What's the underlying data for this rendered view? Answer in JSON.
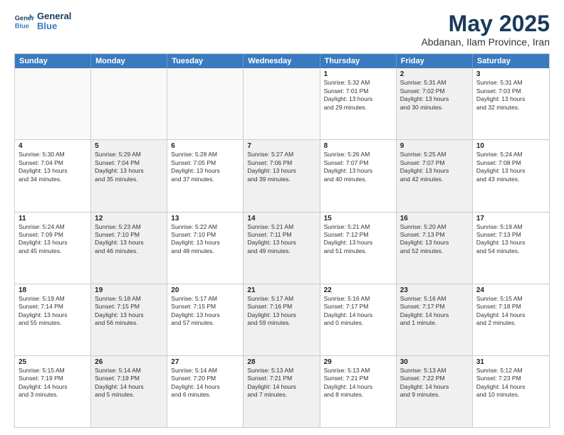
{
  "logo": {
    "line1": "General",
    "line2": "Blue"
  },
  "title": "May 2025",
  "subtitle": "Abdanan, Ilam Province, Iran",
  "headers": [
    "Sunday",
    "Monday",
    "Tuesday",
    "Wednesday",
    "Thursday",
    "Friday",
    "Saturday"
  ],
  "weeks": [
    [
      {
        "num": "",
        "info": "",
        "empty": true
      },
      {
        "num": "",
        "info": "",
        "empty": true
      },
      {
        "num": "",
        "info": "",
        "empty": true
      },
      {
        "num": "",
        "info": "",
        "empty": true
      },
      {
        "num": "1",
        "info": "Sunrise: 5:32 AM\nSunset: 7:01 PM\nDaylight: 13 hours\nand 29 minutes.",
        "shaded": false
      },
      {
        "num": "2",
        "info": "Sunrise: 5:31 AM\nSunset: 7:02 PM\nDaylight: 13 hours\nand 30 minutes.",
        "shaded": true
      },
      {
        "num": "3",
        "info": "Sunrise: 5:31 AM\nSunset: 7:03 PM\nDaylight: 13 hours\nand 32 minutes.",
        "shaded": false
      }
    ],
    [
      {
        "num": "4",
        "info": "Sunrise: 5:30 AM\nSunset: 7:04 PM\nDaylight: 13 hours\nand 34 minutes.",
        "shaded": false
      },
      {
        "num": "5",
        "info": "Sunrise: 5:29 AM\nSunset: 7:04 PM\nDaylight: 13 hours\nand 35 minutes.",
        "shaded": true
      },
      {
        "num": "6",
        "info": "Sunrise: 5:28 AM\nSunset: 7:05 PM\nDaylight: 13 hours\nand 37 minutes.",
        "shaded": false
      },
      {
        "num": "7",
        "info": "Sunrise: 5:27 AM\nSunset: 7:06 PM\nDaylight: 13 hours\nand 39 minutes.",
        "shaded": true
      },
      {
        "num": "8",
        "info": "Sunrise: 5:26 AM\nSunset: 7:07 PM\nDaylight: 13 hours\nand 40 minutes.",
        "shaded": false
      },
      {
        "num": "9",
        "info": "Sunrise: 5:25 AM\nSunset: 7:07 PM\nDaylight: 13 hours\nand 42 minutes.",
        "shaded": true
      },
      {
        "num": "10",
        "info": "Sunrise: 5:24 AM\nSunset: 7:08 PM\nDaylight: 13 hours\nand 43 minutes.",
        "shaded": false
      }
    ],
    [
      {
        "num": "11",
        "info": "Sunrise: 5:24 AM\nSunset: 7:09 PM\nDaylight: 13 hours\nand 45 minutes.",
        "shaded": false
      },
      {
        "num": "12",
        "info": "Sunrise: 5:23 AM\nSunset: 7:10 PM\nDaylight: 13 hours\nand 46 minutes.",
        "shaded": true
      },
      {
        "num": "13",
        "info": "Sunrise: 5:22 AM\nSunset: 7:10 PM\nDaylight: 13 hours\nand 48 minutes.",
        "shaded": false
      },
      {
        "num": "14",
        "info": "Sunrise: 5:21 AM\nSunset: 7:11 PM\nDaylight: 13 hours\nand 49 minutes.",
        "shaded": true
      },
      {
        "num": "15",
        "info": "Sunrise: 5:21 AM\nSunset: 7:12 PM\nDaylight: 13 hours\nand 51 minutes.",
        "shaded": false
      },
      {
        "num": "16",
        "info": "Sunrise: 5:20 AM\nSunset: 7:13 PM\nDaylight: 13 hours\nand 52 minutes.",
        "shaded": true
      },
      {
        "num": "17",
        "info": "Sunrise: 5:19 AM\nSunset: 7:13 PM\nDaylight: 13 hours\nand 54 minutes.",
        "shaded": false
      }
    ],
    [
      {
        "num": "18",
        "info": "Sunrise: 5:19 AM\nSunset: 7:14 PM\nDaylight: 13 hours\nand 55 minutes.",
        "shaded": false
      },
      {
        "num": "19",
        "info": "Sunrise: 5:18 AM\nSunset: 7:15 PM\nDaylight: 13 hours\nand 56 minutes.",
        "shaded": true
      },
      {
        "num": "20",
        "info": "Sunrise: 5:17 AM\nSunset: 7:15 PM\nDaylight: 13 hours\nand 57 minutes.",
        "shaded": false
      },
      {
        "num": "21",
        "info": "Sunrise: 5:17 AM\nSunset: 7:16 PM\nDaylight: 13 hours\nand 59 minutes.",
        "shaded": true
      },
      {
        "num": "22",
        "info": "Sunrise: 5:16 AM\nSunset: 7:17 PM\nDaylight: 14 hours\nand 0 minutes.",
        "shaded": false
      },
      {
        "num": "23",
        "info": "Sunrise: 5:16 AM\nSunset: 7:17 PM\nDaylight: 14 hours\nand 1 minute.",
        "shaded": true
      },
      {
        "num": "24",
        "info": "Sunrise: 5:15 AM\nSunset: 7:18 PM\nDaylight: 14 hours\nand 2 minutes.",
        "shaded": false
      }
    ],
    [
      {
        "num": "25",
        "info": "Sunrise: 5:15 AM\nSunset: 7:19 PM\nDaylight: 14 hours\nand 3 minutes.",
        "shaded": false
      },
      {
        "num": "26",
        "info": "Sunrise: 5:14 AM\nSunset: 7:19 PM\nDaylight: 14 hours\nand 5 minutes.",
        "shaded": true
      },
      {
        "num": "27",
        "info": "Sunrise: 5:14 AM\nSunset: 7:20 PM\nDaylight: 14 hours\nand 6 minutes.",
        "shaded": false
      },
      {
        "num": "28",
        "info": "Sunrise: 5:13 AM\nSunset: 7:21 PM\nDaylight: 14 hours\nand 7 minutes.",
        "shaded": true
      },
      {
        "num": "29",
        "info": "Sunrise: 5:13 AM\nSunset: 7:21 PM\nDaylight: 14 hours\nand 8 minutes.",
        "shaded": false
      },
      {
        "num": "30",
        "info": "Sunrise: 5:13 AM\nSunset: 7:22 PM\nDaylight: 14 hours\nand 9 minutes.",
        "shaded": true
      },
      {
        "num": "31",
        "info": "Sunrise: 5:12 AM\nSunset: 7:23 PM\nDaylight: 14 hours\nand 10 minutes.",
        "shaded": false
      }
    ]
  ]
}
